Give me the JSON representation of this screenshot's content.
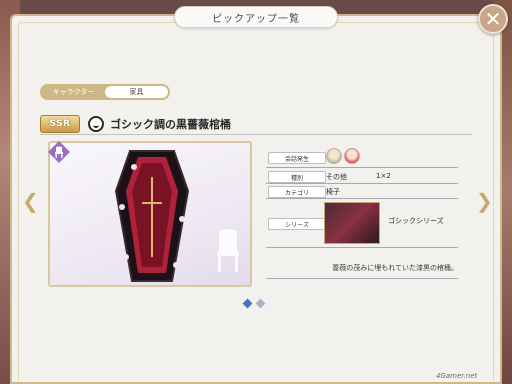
{
  "window": {
    "title": "ピックアップ一覧",
    "close_glyph": "✕"
  },
  "tabs": [
    {
      "label": "キャラクター",
      "active": false
    },
    {
      "label": "家具",
      "active": true
    }
  ],
  "item": {
    "rarity": "SSR",
    "name": "ゴシック調の黒薔薇棺桶"
  },
  "info": {
    "conversation": {
      "label": "会話発生"
    },
    "kind": {
      "label": "種別",
      "value": "その他",
      "size": "1×2"
    },
    "category": {
      "label": "カテゴリ",
      "value": "椅子"
    },
    "series": {
      "label": "シリーズ",
      "value": "ゴシックシリーズ"
    }
  },
  "description": "薔薇の茂みに埋もれていた漆黒の棺桶。",
  "pager": {
    "total": 2,
    "current": 1
  },
  "nav": {
    "prev_glyph": "❮",
    "next_glyph": "❯"
  },
  "watermark": "4Gamer.net",
  "colors": {
    "accent_gold": "#cdb785",
    "rarity_purple": "#9a6fc1",
    "coffin_red": "#b0223a",
    "page_dot_active": "#4a6fc8"
  },
  "icons": [
    "close-icon",
    "chair-icon",
    "face-icon",
    "prev-arrow-icon",
    "next-arrow-icon"
  ]
}
